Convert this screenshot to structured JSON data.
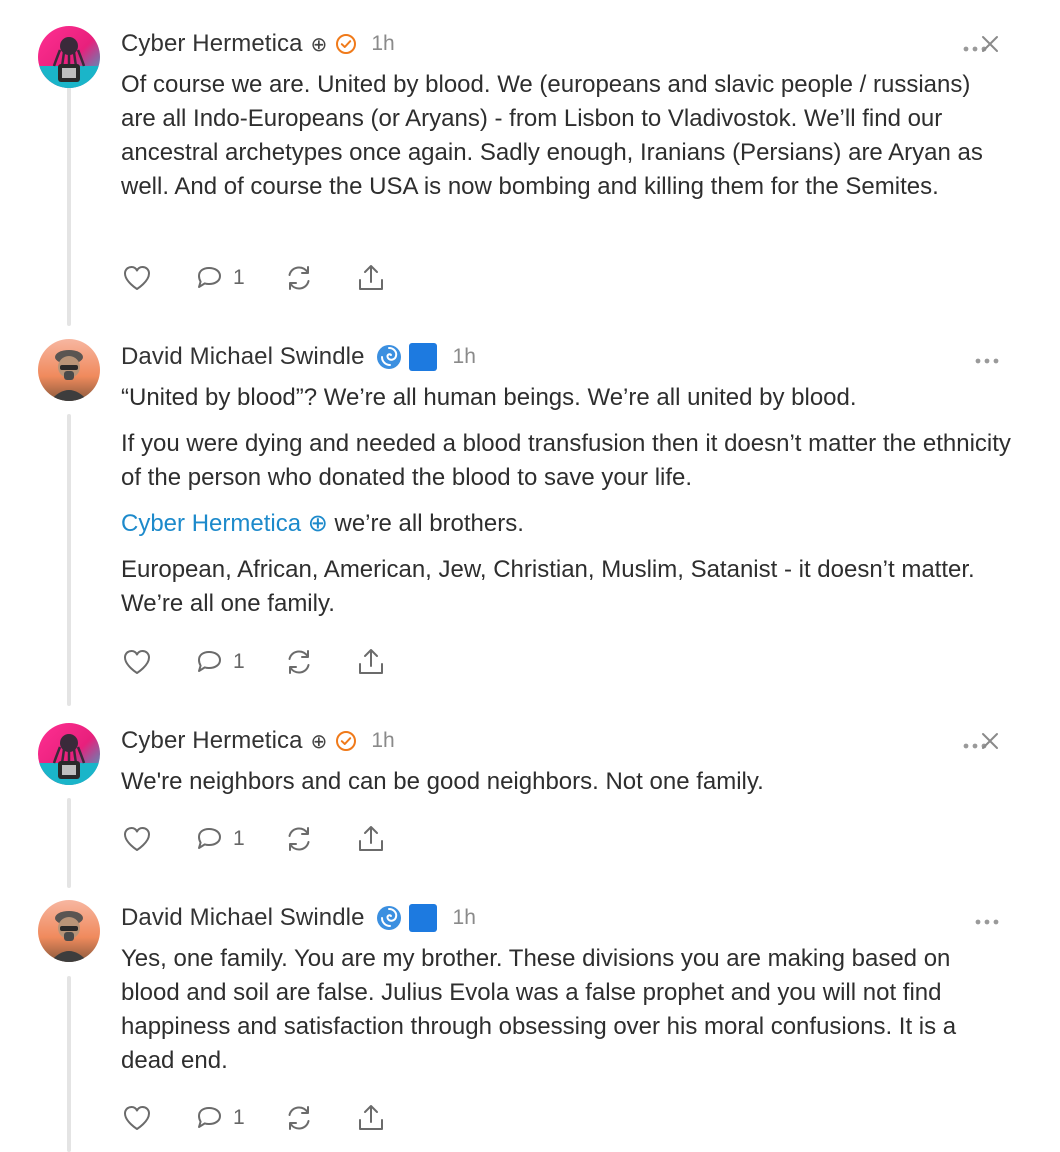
{
  "comments": [
    {
      "author": "Cyber Hermetica",
      "author_badge": "⊕",
      "verified_icon": "orange-check-icon",
      "time": "1h",
      "paragraphs": [
        "Of course we are. United by blood. We (europeans and slavic people / russians) are all Indo-Europeans (or Aryans) - from Lisbon to Vladivostok. We’ll find our ancestral archetypes once again. Sadly enough, Iranians (Persians) are Aryan as well. And of course the USA is now bombing and killing them for the Semites."
      ],
      "reply_count": "1"
    },
    {
      "author": "David Michael Swindle",
      "author_badge": "🌀🟦",
      "time": "1h",
      "paragraphs": [
        "“United by blood”? We’re all human beings. We’re all united by blood.",
        "If you were dying and needed a blood transfusion then it doesn’t matter the ethnicity of the person who donated the blood to save your life."
      ],
      "mention": "Cyber Hermetica ⊕",
      "mention_suffix": " we’re all brothers.",
      "paragraphs_after": [
        "European, African, American, Jew, Christian, Muslim, Satanist - it doesn’t matter. We’re all one family."
      ],
      "reply_count": "1"
    },
    {
      "author": "Cyber Hermetica",
      "author_badge": "⊕",
      "verified_icon": "orange-check-icon",
      "time": "1h",
      "paragraphs": [
        "We're neighbors and can be good neighbors. Not one family."
      ],
      "reply_count": "1"
    },
    {
      "author": "David Michael Swindle",
      "author_badge": "🌀🟦",
      "time": "1h",
      "paragraphs": [
        "Yes, one family. You are my brother. These divisions you are making based on blood and soil are false. Julius Evola was a false prophet and you will not find happiness and satisfaction through obsessing over his moral confusions. It is a dead end."
      ],
      "reply_count": "1"
    }
  ],
  "colors": {
    "mention": "#1d8acb",
    "verified": "#f07a1a",
    "thread_line": "#e4e4e4",
    "icon_gray": "#6b6b6b"
  }
}
